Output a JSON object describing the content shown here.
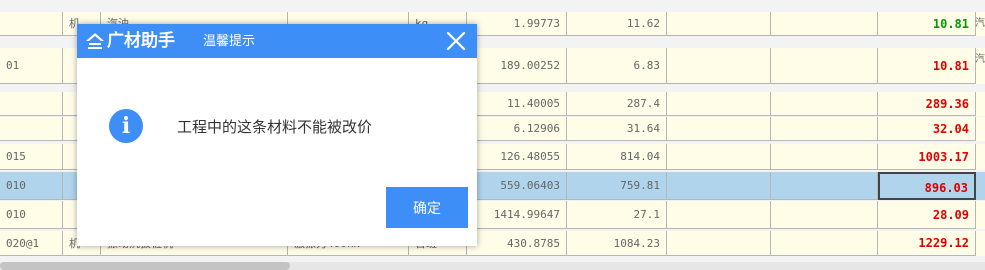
{
  "rows": [
    {
      "code": "",
      "type": "机",
      "name": "汽油",
      "spec": "",
      "unit": "kg",
      "qty": "1.99773",
      "base": "11.62",
      "price": "10.81",
      "color": "green",
      "vert": "汽"
    },
    {
      "code": "01",
      "type": "",
      "name": "",
      "spec": "",
      "unit": "",
      "qty": "189.00252",
      "base": "6.83",
      "price": "10.81",
      "color": "red",
      "vert": "汽"
    },
    {
      "code": "",
      "type": "",
      "name": "",
      "spec": "",
      "unit": "",
      "qty": "11.40005",
      "base": "287.4",
      "price": "289.36",
      "color": "red",
      "vert": ""
    },
    {
      "code": "",
      "type": "",
      "name": "",
      "spec": "",
      "unit": "",
      "qty": "6.12906",
      "base": "31.64",
      "price": "32.04",
      "color": "red",
      "vert": ""
    },
    {
      "code": "015",
      "type": "",
      "name": "",
      "spec": "",
      "unit": "",
      "qty": "126.48055",
      "base": "814.04",
      "price": "1003.17",
      "color": "red",
      "vert": ""
    },
    {
      "code": "010",
      "type": "",
      "name": "",
      "spec": "",
      "unit": "",
      "qty": "559.06403",
      "base": "759.81",
      "price": "896.03",
      "color": "red",
      "vert": "",
      "selected": true
    },
    {
      "code": "010",
      "type": "",
      "name": "",
      "spec": "",
      "unit": "",
      "qty": "1414.99647",
      "base": "27.1",
      "price": "28.09",
      "color": "red",
      "vert": ""
    },
    {
      "code": "020@1",
      "type": "机",
      "name": "振动沉拔桩机",
      "spec": "激振力400kN",
      "unit": "台班",
      "qty": "430.8785",
      "base": "1084.23",
      "price": "1229.12",
      "color": "red",
      "vert": ""
    }
  ],
  "dialog": {
    "brand": "广材助手",
    "title": "温馨提示",
    "close_label": "✕",
    "info_glyph": "i",
    "message": "工程中的这条材料不能被改价",
    "ok_label": "确定"
  },
  "colors": {
    "accent": "#3e8ef7",
    "row_bg": "#fffde7",
    "selected_bg": "#b0d4ec",
    "price_red": "#e00000",
    "price_green": "#009c00"
  }
}
